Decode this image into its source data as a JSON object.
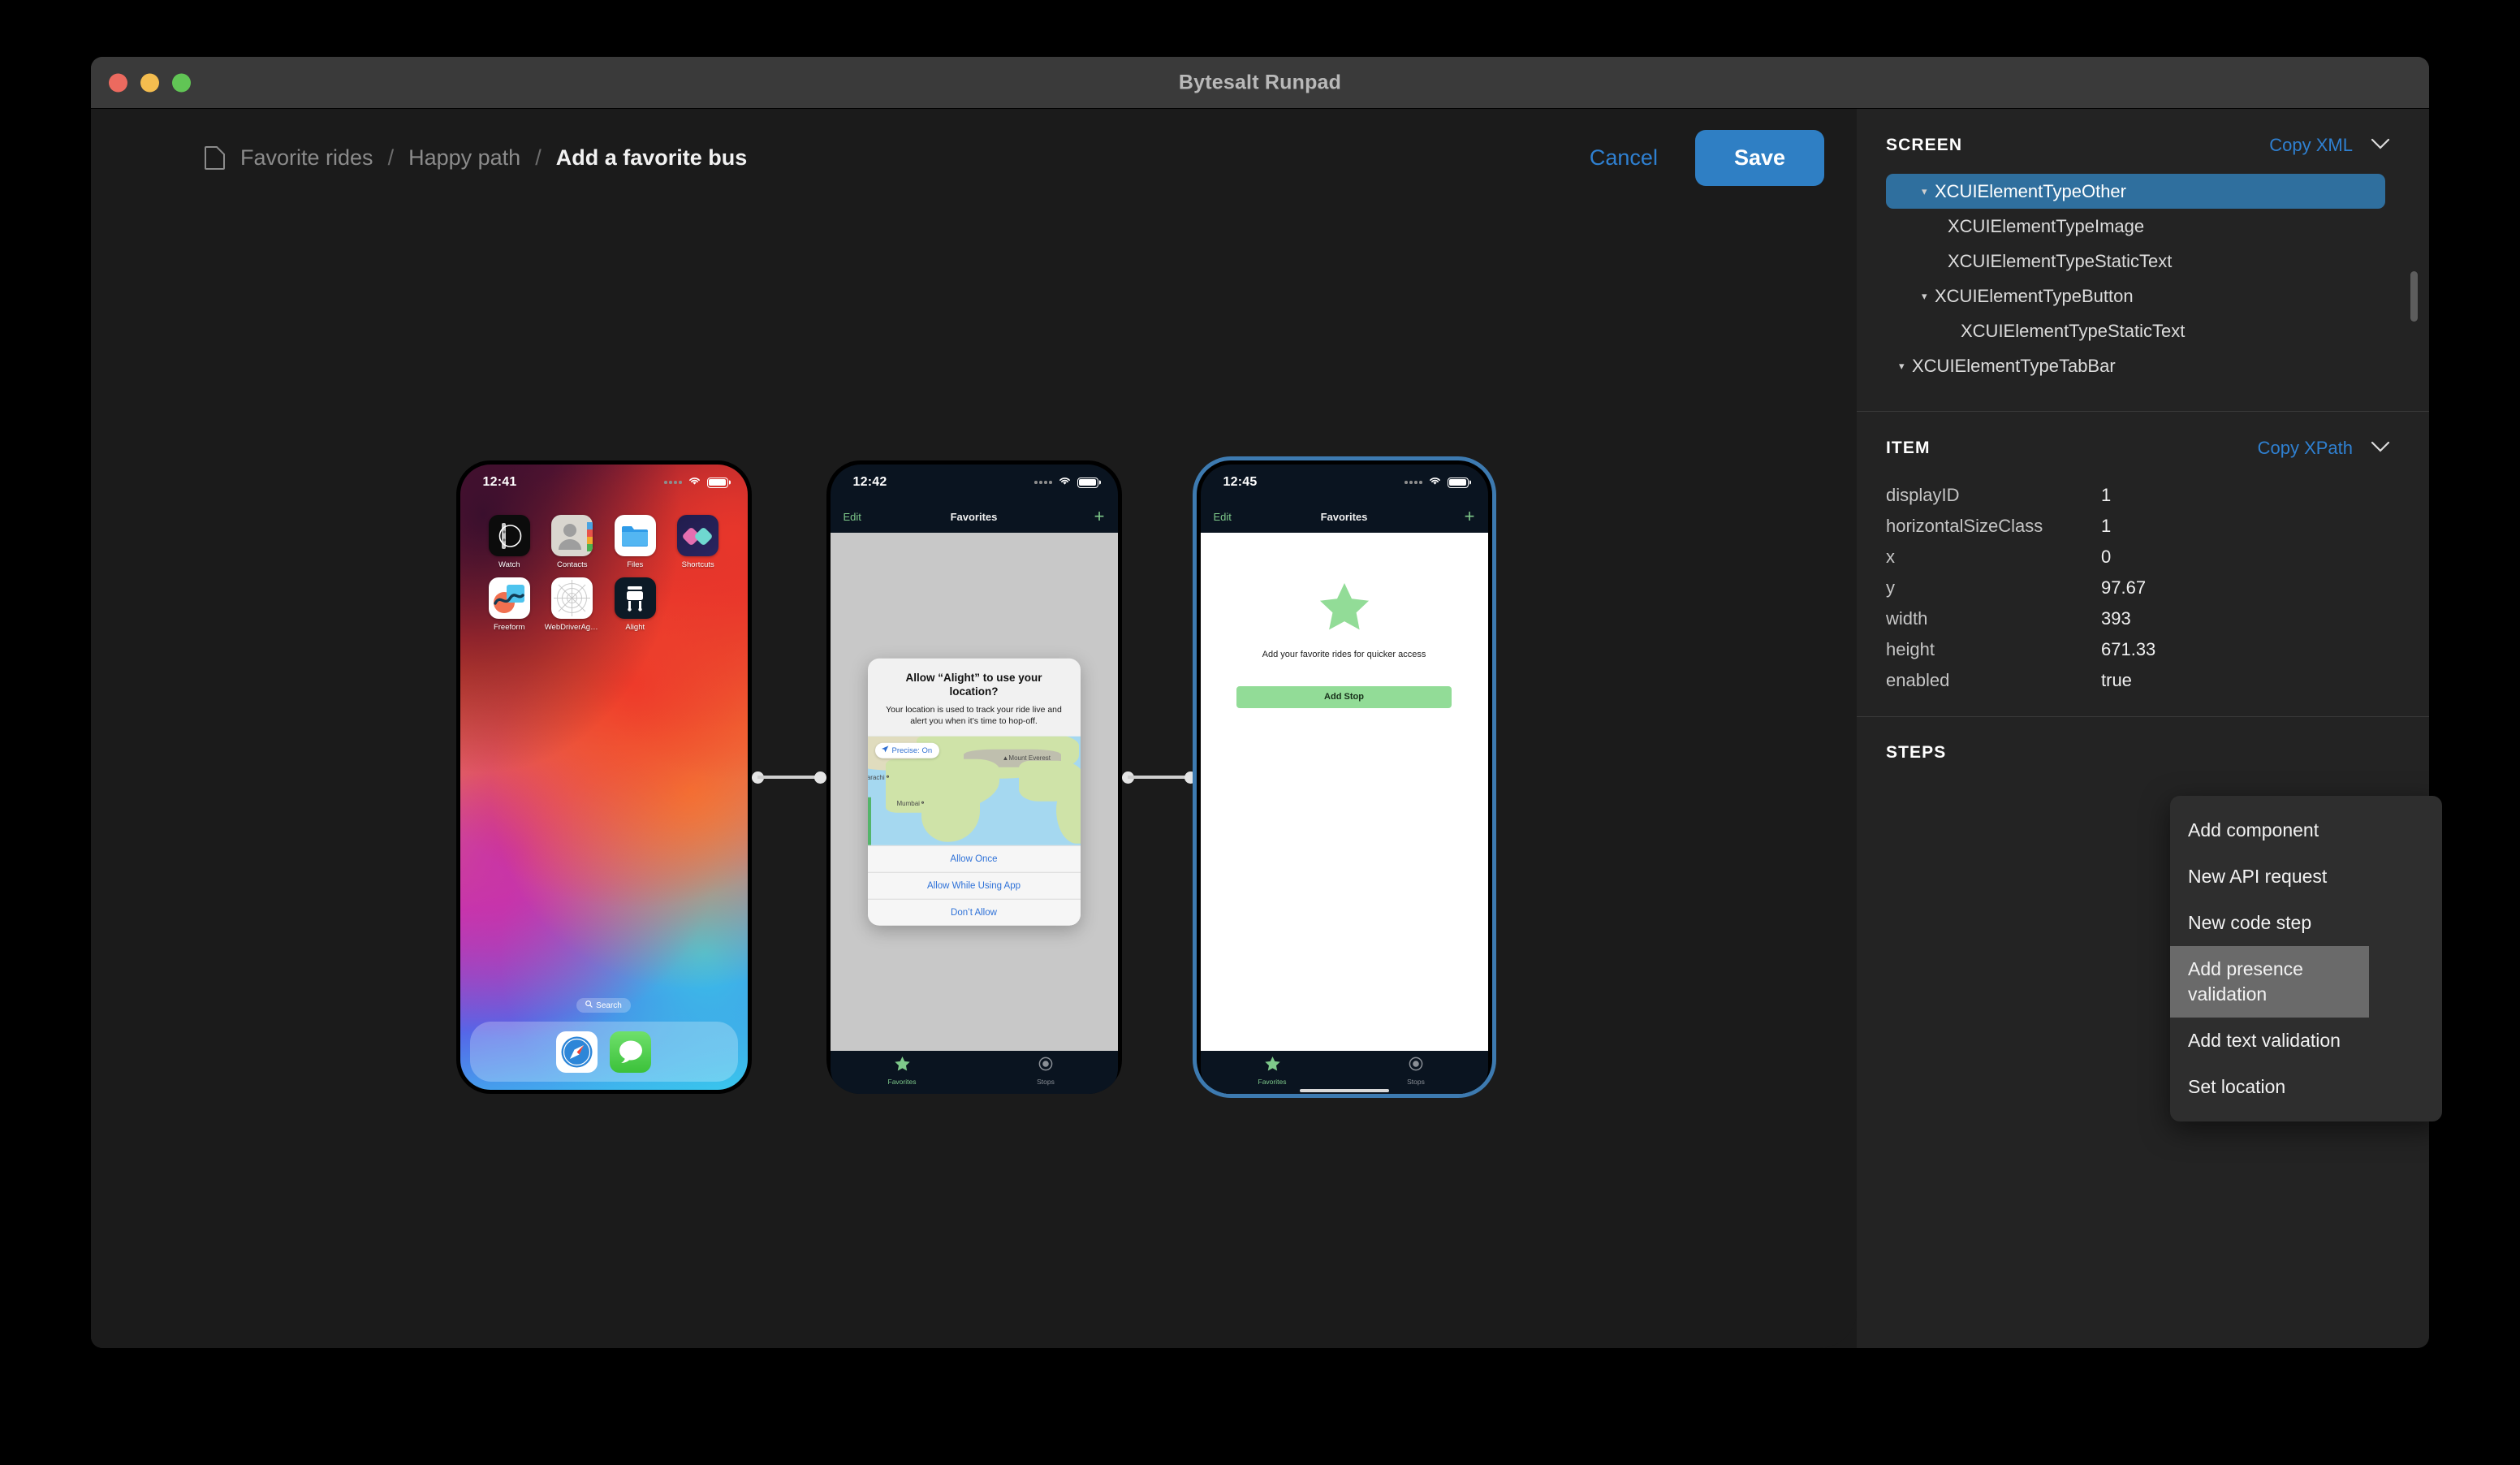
{
  "window": {
    "title": "Bytesalt Runpad",
    "traffic_lights": [
      "close",
      "minimize",
      "maximize"
    ]
  },
  "topbar": {
    "breadcrumb": [
      {
        "label": "Favorite rides",
        "active": false
      },
      {
        "label": "Happy path",
        "active": false
      },
      {
        "label": "Add a favorite bus",
        "active": true
      }
    ],
    "separator": "/",
    "cancel_label": "Cancel",
    "save_label": "Save"
  },
  "flow": {
    "phones": [
      {
        "kind": "home-screen",
        "status": {
          "time": "12:41"
        },
        "apps": [
          {
            "label": "Watch",
            "icon": "watch-icon"
          },
          {
            "label": "Contacts",
            "icon": "contacts-icon"
          },
          {
            "label": "Files",
            "icon": "files-icon"
          },
          {
            "label": "Shortcuts",
            "icon": "shortcuts-icon"
          },
          {
            "label": "Freeform",
            "icon": "freeform-icon"
          },
          {
            "label": "WebDriverAge...",
            "icon": "webdriveragent-icon"
          },
          {
            "label": "Alight",
            "icon": "alight-icon"
          }
        ],
        "search_label": "Search",
        "dock": [
          {
            "label": "Safari",
            "icon": "safari-icon"
          },
          {
            "label": "Messages",
            "icon": "messages-icon"
          }
        ]
      },
      {
        "kind": "permission-dialog",
        "selected": false,
        "status": {
          "time": "12:42"
        },
        "navbar": {
          "left": "Edit",
          "title": "Favorites",
          "right": "+"
        },
        "dialog": {
          "title": "Allow “Alight” to use your location?",
          "body": "Your location is used to track your ride live and alert you when it’s time to hop-off.",
          "precise_label": "Precise: On",
          "map_labels": [
            "Karachi",
            "Mumbai",
            "Mount Everest"
          ],
          "buttons": [
            "Allow Once",
            "Allow While Using App",
            "Don’t Allow"
          ]
        },
        "tabs": [
          {
            "label": "Favorites",
            "icon": "star-icon",
            "active": true
          },
          {
            "label": "Stops",
            "icon": "circle-dot-icon",
            "active": false
          }
        ]
      },
      {
        "kind": "empty-state",
        "selected": true,
        "status": {
          "time": "12:45"
        },
        "navbar": {
          "left": "Edit",
          "title": "Favorites",
          "right": "+"
        },
        "empty": {
          "icon": "star-icon",
          "text": "Add your favorite rides for quicker access",
          "button_label": "Add Stop"
        },
        "tabs": [
          {
            "label": "Favorites",
            "icon": "star-icon",
            "active": true
          },
          {
            "label": "Stops",
            "icon": "circle-dot-icon",
            "active": false
          }
        ]
      }
    ]
  },
  "sidebar": {
    "screen": {
      "title": "SCREEN",
      "action_label": "Copy XML",
      "tree": [
        {
          "label": "XCUIElementTypeOther",
          "indent": 1,
          "expandable": true,
          "expanded": true,
          "selected": true
        },
        {
          "label": "XCUIElementTypeImage",
          "indent": 2,
          "expandable": false,
          "selected": false
        },
        {
          "label": "XCUIElementTypeStaticText",
          "indent": 2,
          "expandable": false,
          "selected": false
        },
        {
          "label": "XCUIElementTypeButton",
          "indent": 1,
          "expandable": true,
          "expanded": true,
          "selected": false
        },
        {
          "label": "XCUIElementTypeStaticText",
          "indent": 2,
          "expandable": false,
          "selected": false
        },
        {
          "label": "XCUIElementTypeTabBar",
          "indent": 0,
          "expandable": true,
          "expanded": true,
          "selected": false
        }
      ]
    },
    "item": {
      "title": "ITEM",
      "action_label": "Copy XPath",
      "properties": [
        {
          "key": "displayID",
          "value": "1"
        },
        {
          "key": "horizontalSizeClass",
          "value": "1"
        },
        {
          "key": "x",
          "value": "0"
        },
        {
          "key": "y",
          "value": "97.67"
        },
        {
          "key": "width",
          "value": "393"
        },
        {
          "key": "height",
          "value": "671.33"
        },
        {
          "key": "enabled",
          "value": "true"
        }
      ]
    },
    "steps": {
      "title": "STEPS"
    }
  },
  "context_menu": {
    "items": [
      {
        "label": "Add component",
        "highlighted": false
      },
      {
        "label": "New API request",
        "highlighted": false
      },
      {
        "label": "New code step",
        "highlighted": false
      },
      {
        "label": "Add presence validation",
        "highlighted": true
      },
      {
        "label": "Add text validation",
        "highlighted": false
      },
      {
        "label": "Set location",
        "highlighted": false
      }
    ]
  },
  "colors": {
    "accent_blue": "#2f80d1",
    "save_blue": "#2f7fc4",
    "tree_selected": "#2f6f9e",
    "app_green": "#7ec98a",
    "button_green": "#92dc97",
    "window_bg": "#1b1b1b",
    "sidebar_bg": "#232323"
  }
}
